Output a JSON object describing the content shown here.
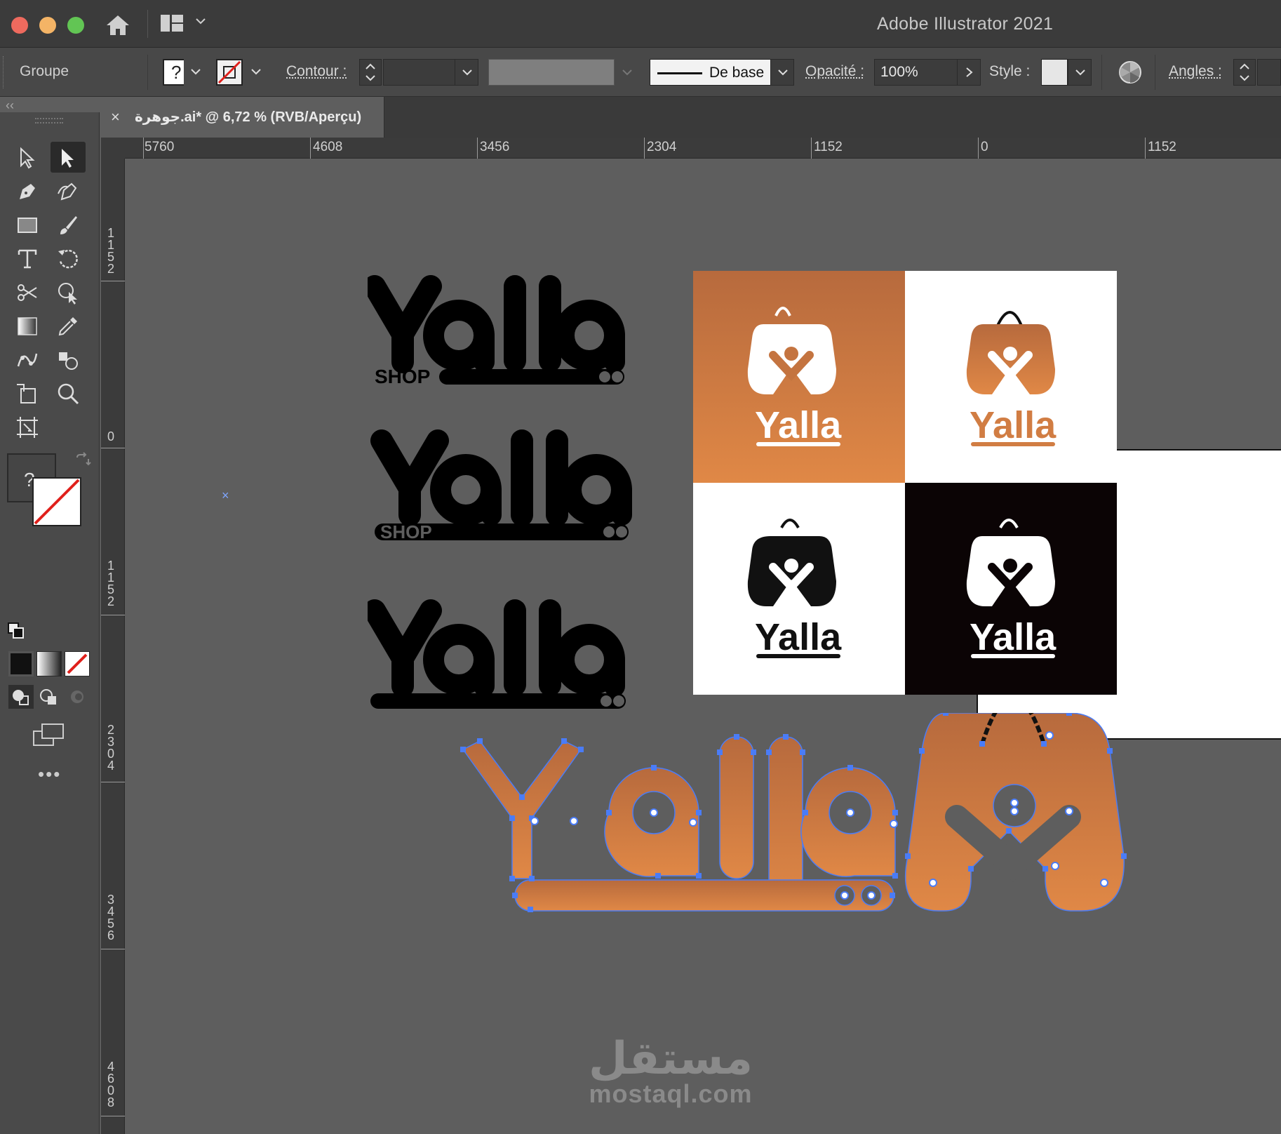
{
  "window": {
    "title": "Adobe Illustrator 2021"
  },
  "control_bar": {
    "selection_type": "Groupe",
    "contour_label": "Contour :",
    "stroke_profile": "De base",
    "opacity_label": "Opacité :",
    "opacity_value": "100%",
    "style_label": "Style :",
    "angles_label": "Angles :"
  },
  "document_tab": {
    "title": "جوهرة.ai* @ 6,72 % (RVB/Aperçu)",
    "close": "×"
  },
  "toolbar": {
    "fill_unknown": "?",
    "more": "•••",
    "tools": [
      "selection-tool",
      "direct-selection-tool",
      "pen-tool",
      "curvature-tool",
      "rectangle-tool",
      "paintbrush-tool",
      "type-tool",
      "rotate-tool",
      "scissors-tool",
      "shape-builder-tool",
      "gradient-tool",
      "eyedropper-tool",
      "blend-tool",
      "symbol-sprayer-tool",
      "free-transform-tool",
      "zoom-tool",
      "artboard-tool"
    ]
  },
  "control_bar_fill": "?",
  "ruler_horizontal": [
    "5760",
    "4608",
    "3456",
    "2304",
    "1152",
    "0",
    "1152"
  ],
  "ruler_vertical": [
    "1152",
    "0",
    "1152",
    "2304",
    "3456",
    "4608"
  ],
  "artwork": {
    "wordmark": "Yalla",
    "shop_text": "SHOP",
    "brand_colors": {
      "orange_top": "#b76a3d",
      "orange_bottom": "#e08846",
      "black": "#0b0405",
      "path_selection": "#4a7cf7"
    }
  },
  "watermark": {
    "arabic": "مستقل",
    "latin": "mostaql.com"
  }
}
